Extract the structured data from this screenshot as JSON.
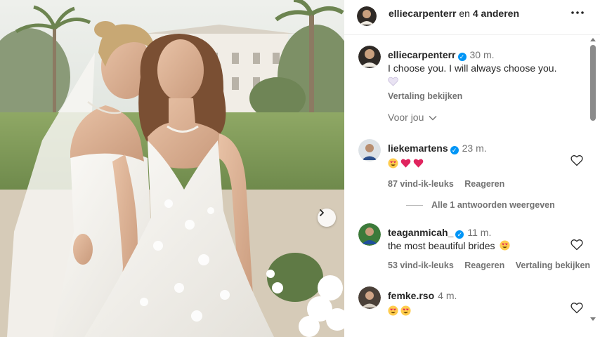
{
  "header": {
    "username": "elliecarpenterr",
    "connector": "en",
    "others": "4 anderen",
    "more_icon": "more-horizontal-icon"
  },
  "caption": {
    "username": "elliecarpenterr",
    "time": "30 m.",
    "text": "I choose you. I will always choose you.",
    "emoji": "white-heart",
    "translate": "Vertaling bekijken"
  },
  "for_you": "Voor jou",
  "comments": [
    {
      "username": "liekemartens",
      "time": "23 m.",
      "emojis": [
        "heart-eyes",
        "red-heart",
        "red-heart"
      ],
      "likes": "87 vind-ik-leuks",
      "reply": "Reageren",
      "translate": ""
    },
    {
      "username": "teaganmicah_",
      "time": "11 m.",
      "text": "the most beautiful brides",
      "emojis": [
        "heart-eyes"
      ],
      "likes": "53 vind-ik-leuks",
      "reply": "Reageren",
      "translate": "Vertaling bekijken"
    },
    {
      "username": "femke.rso",
      "time": "4 m.",
      "emojis": [
        "heart-eyes",
        "heart-eyes"
      ]
    }
  ],
  "replies_link": "Alle 1 antwoorden weergeven",
  "colors": {
    "verified": "#0095f6",
    "secondary_text": "#737373",
    "primary_text": "#262626"
  }
}
